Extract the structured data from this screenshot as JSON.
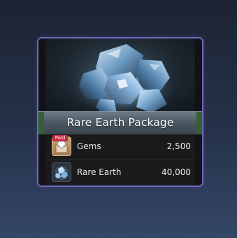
{
  "package": {
    "title": "Rare Earth Package",
    "border_color": "#6d67b8",
    "banner_color": "#4a5762",
    "artwork_icon": "crystal-cluster-icon"
  },
  "items": [
    {
      "name": "Gems",
      "value": "2,500",
      "icon": "gem-chest-icon",
      "badge": "Paid",
      "badge_color": "#c8283a"
    },
    {
      "name": "Rare Earth",
      "value": "40,000",
      "icon": "rare-earth-crystal-icon"
    }
  ]
}
